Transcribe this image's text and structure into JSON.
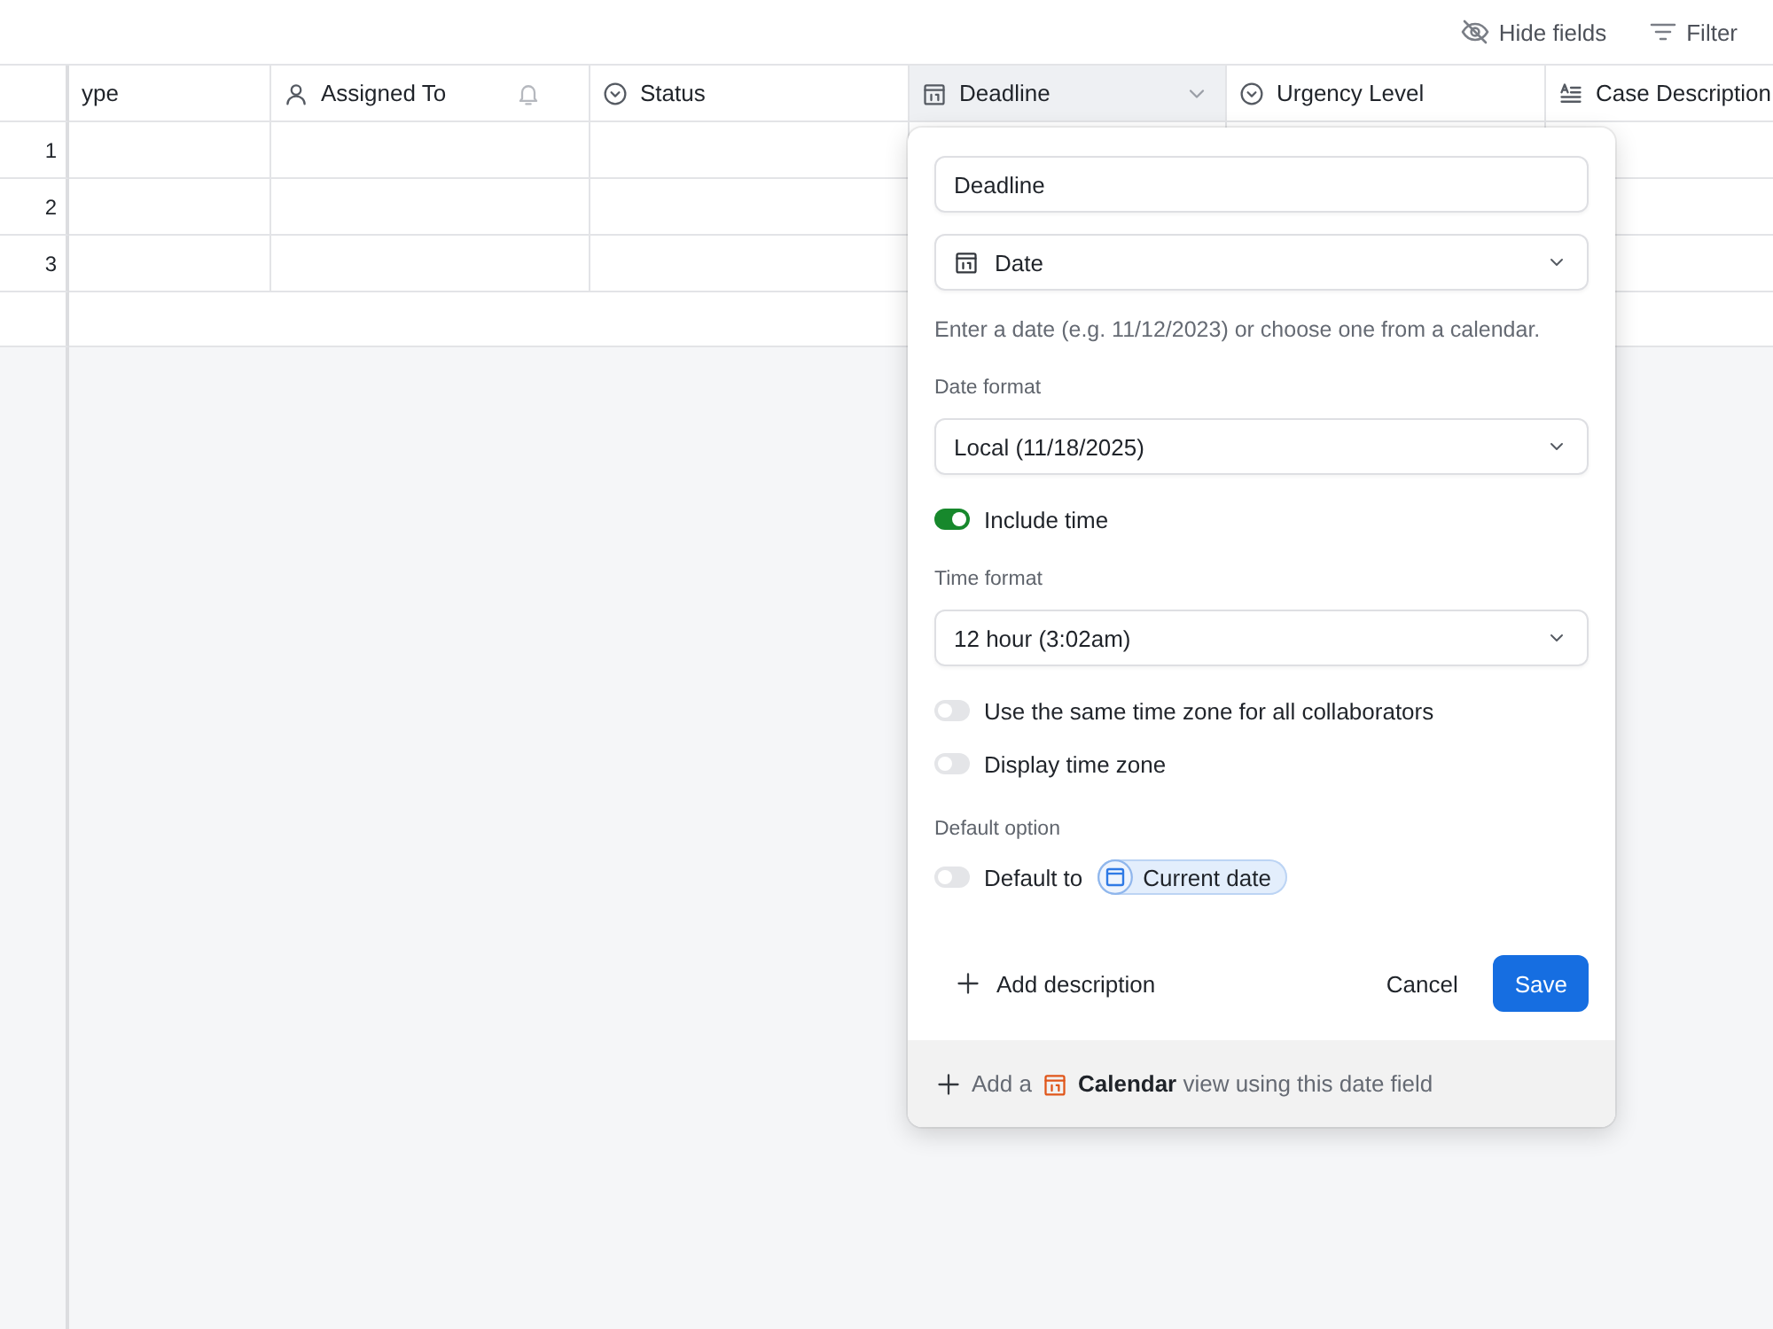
{
  "toolbar": {
    "buttons": [
      {
        "kind": "hide",
        "label": "Hide fields"
      },
      {
        "kind": "filter",
        "label": "Filter"
      }
    ]
  },
  "table": {
    "columns": [
      {
        "label": "ype",
        "selected": false
      },
      {
        "label": "Assigned To",
        "kind": "user",
        "selected": false
      },
      {
        "label": "Status",
        "kind": "select",
        "selected": false
      },
      {
        "label": "Deadline",
        "kind": "date",
        "selected": true
      },
      {
        "label": "Urgency Level",
        "kind": "select",
        "selected": false
      },
      {
        "label": "Case Description",
        "kind": "long_text",
        "selected": false
      }
    ],
    "rows": [
      {
        "number": "1"
      },
      {
        "number": "2"
      },
      {
        "number": "3"
      }
    ]
  },
  "field_editor": {
    "name": {
      "value": "Deadline"
    },
    "type": {
      "kind": "date",
      "value": "Date"
    },
    "help": "Enter a date (e.g. 11/12/2023) or choose one from a calendar.",
    "date_format": {
      "label": "Date format",
      "value": "Local (11/18/2025)"
    },
    "include_time": {
      "label": "Include time",
      "on": true
    },
    "time_format": {
      "label": "Time format",
      "value": "12 hour (3:02am)"
    },
    "options": [
      {
        "label": "Use the same time zone for all collaborators",
        "on": false
      },
      {
        "label": "Display time zone",
        "on": false
      }
    ],
    "default_option": {
      "heading": "Default option",
      "label": "Default to",
      "on": false,
      "chip": "Current date"
    },
    "add_description": "Add description",
    "buttons": [
      {
        "kind": "cancel",
        "label": "Cancel"
      },
      {
        "kind": "save",
        "label": "Save"
      }
    ],
    "footer": {
      "prefix": "Add a",
      "text": "**Calendar** view using this date field"
    }
  }
}
